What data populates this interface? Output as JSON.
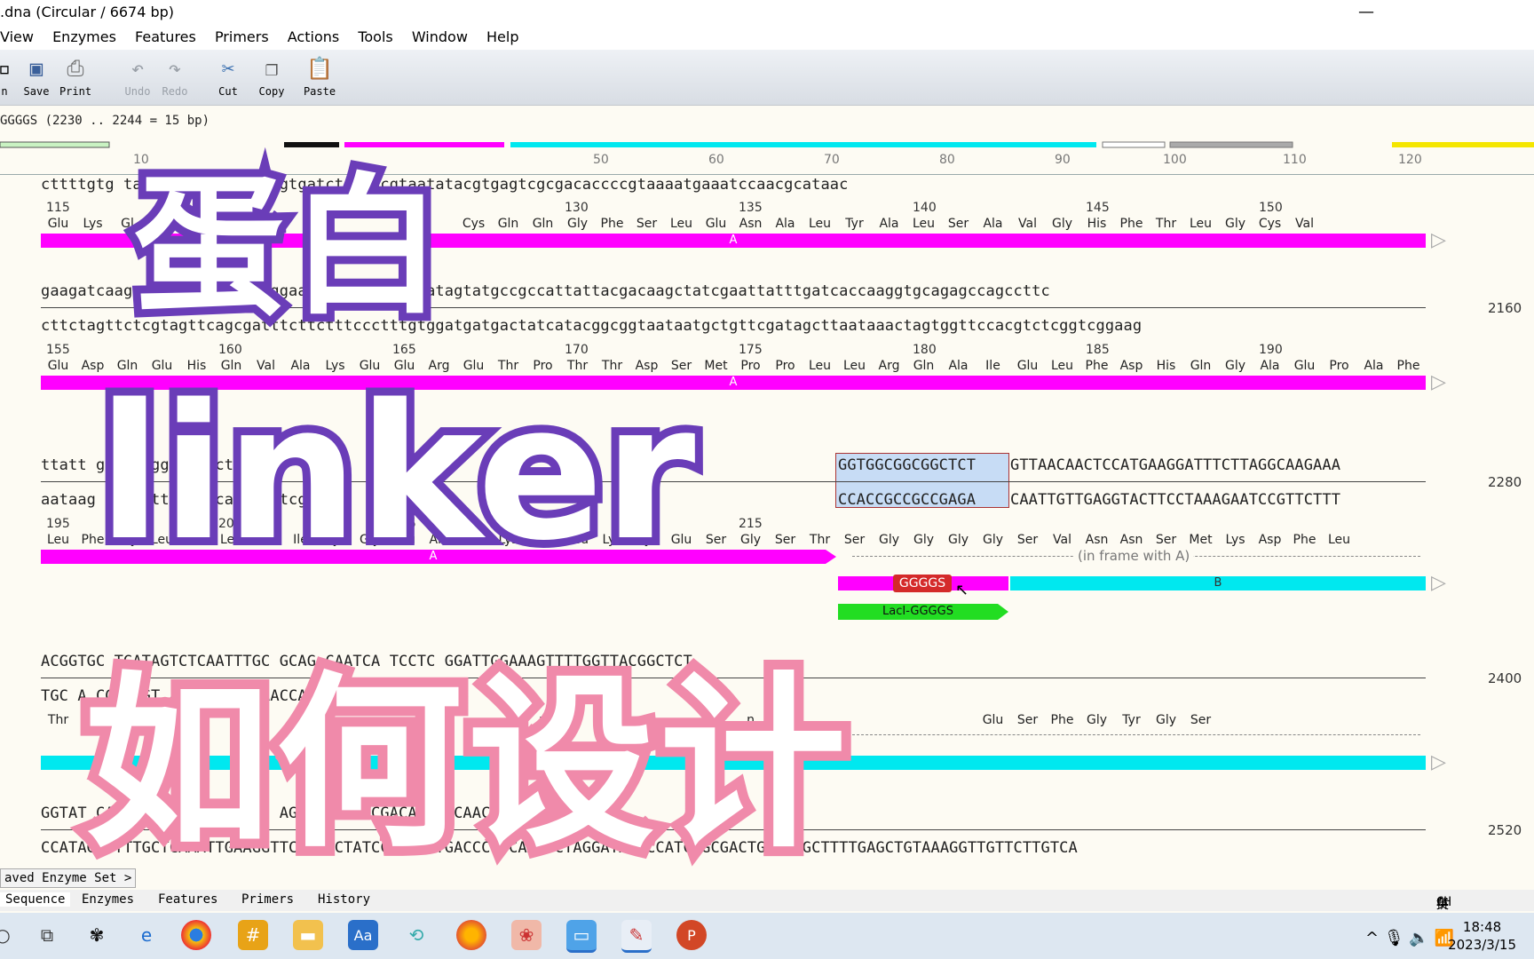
{
  "window": {
    "title": ".dna  (Circular / 6674 bp)",
    "minimize": "—"
  },
  "menu": [
    "View",
    "Enzymes",
    "Features",
    "Primers",
    "Actions",
    "Tools",
    "Window",
    "Help"
  ],
  "toolbar": {
    "save": "Save",
    "print": "Print",
    "undo": "Undo",
    "redo": "Redo",
    "cut": "Cut",
    "copy": "Copy",
    "paste": "Paste",
    "partial": "n"
  },
  "selection_status": "GGGGS (2230 .. 2244 = 15 bp)",
  "ruler": [
    "10",
    "50",
    "60",
    "70",
    "80",
    "90",
    "100",
    "110",
    "120"
  ],
  "rows": [
    {
      "top": "cttttgtg                                 tacggttgttccaaaaagtgatctcttacgtaatatacgtgagtcgcgacaccccgtaaaatgaaatccaacgcataac",
      "numbers": [
        "115",
        "130",
        "135",
        "140",
        "145",
        "150"
      ],
      "aa": [
        "Glu",
        "Lys",
        "Gl",
        "",
        "",
        "u",
        "A",
        "",
        "",
        "",
        "",
        "",
        "Cys",
        "Gln",
        "Gln",
        "Gly",
        "Phe",
        "Ser",
        "Leu",
        "Glu",
        "Asn",
        "Ala",
        "Leu",
        "Tyr",
        "Ala",
        "Leu",
        "Ser",
        "Ala",
        "Val",
        "Gly",
        "His",
        "Phe",
        "Thr",
        "Leu",
        "Gly",
        "Cys",
        "Val",
        "Leu"
      ],
      "feature": "A"
    },
    {
      "top": "gaagatcaag           gctaaagaagaaagggaaacacctactactgatagtatgccgccattattacgacaagctatcgaattatttgatcaccaaggtgcagagccagccttc",
      "bottom": "cttctagttctcgtagttcagcgatttcttctttccctttgtggatgatgactatcatacggcggtaataatgctgttcgatagcttaataaactagtggttccacgtctcggtcggaag",
      "numbers": [
        "155",
        "160",
        "165",
        "170",
        "175",
        "180",
        "185",
        "190"
      ],
      "aa": [
        "Glu",
        "Asp",
        "Gln",
        "Glu",
        "His",
        "Gln",
        "Val",
        "Ala",
        "Lys",
        "Glu",
        "Glu",
        "Arg",
        "Glu",
        "Thr",
        "Pro",
        "Thr",
        "Thr",
        "Asp",
        "Ser",
        "Met",
        "Pro",
        "Pro",
        "Leu",
        "Leu",
        "Arg",
        "Gln",
        "Ala",
        "Ile",
        "Glu",
        "Leu",
        "Phe",
        "Asp",
        "His",
        "Gln",
        "Gly",
        "Ala",
        "Glu",
        "Pro",
        "Ala",
        "Phe"
      ],
      "feature": "A",
      "right": "2160"
    },
    {
      "top_a": "ttatt                                         gaaagtgggtctactagc",
      "sel_top": "GGTGGCGGCGGCTCT",
      "top_b": "GTTAACAACTCCATGAAGGATTTCTTAGGCAAGAAA",
      "bot_a": "aataag                                      cacactttcacccagatgatcg",
      "sel_bot": "CCACCGCCGCCGAGA",
      "bot_b": "CAATTGTTGAGGTACTTCCTAAAGAATCCGTTCTTT",
      "numbers": [
        "195",
        "200",
        "205",
        "210",
        "215"
      ],
      "aa": [
        "Leu",
        "Phe",
        "Gly",
        "Leu",
        "Glu",
        "Leu",
        "Ile",
        "Ile",
        "Cys",
        "Gly",
        "Leu",
        "Ala",
        "Glu",
        "Lys",
        "Gln",
        "Leu",
        "Lys",
        "Cys",
        "Glu",
        "Ser",
        "Gly",
        "Ser",
        "Thr",
        "Ser",
        "Gly",
        "Gly",
        "Gly",
        "Gly",
        "Ser",
        "Val",
        "Asn",
        "Asn",
        "Ser",
        "Met",
        "Lys",
        "Asp",
        "Phe",
        "Leu",
        "Gly",
        "Lys",
        "Lys"
      ],
      "feature_a": "A",
      "in_frame": "(in frame with A)",
      "linker": "GGGGS",
      "feature_b": "B",
      "lacl": "LacI-GGGGS",
      "right": "2280"
    },
    {
      "top": "ACGGTGC      TGATAGTCTCAATTTGC                  GCAG          CAATCA           TCCTC         GGATTGGAAAGTTTTGGTTACGGCTCT",
      "bottom": "TGC                    A                       CGT          AGT                       AACCTTTCAAAACCAATGCCGAGA",
      "aa": [
        "Thr",
        "",
        "",
        "",
        "",
        "",
        "",
        "",
        "",
        "",
        "",
        "",
        "",
        "",
        "n",
        "",
        "",
        "",
        "",
        "",
        "n",
        "",
        "",
        "",
        "",
        "",
        "",
        "Glu",
        "Ser",
        "Phe",
        "Gly",
        "Tyr",
        "Gly",
        "Ser"
      ],
      "right": "2400"
    },
    {
      "top": "GGTAT               CAAGACT              CAGTT              TAGAC             AGGC      AAACTCGACATTTCCAACAAGAACAGT",
      "bottom": "CCATAGTTTTTGCTCAAATTGAAGGTTCTGAACTATCCAAGTTTGACCCGTCAAGTCTAGGATAAACCATCTGCGACTGCTCCGCTTTTGAGCTGTAAAGGTTGTTCTTGTCA",
      "right": "2520"
    }
  ],
  "overlay": {
    "line1": "蛋白",
    "line2": "linker",
    "line3": "如何设计"
  },
  "enzyme_set": "aved Enzyme Set >",
  "bottom_tabs": [
    "Sequence",
    "Enzymes",
    "Features",
    "Primers",
    "History"
  ],
  "ime": [
    "CH",
    "拼",
    "英",
    "♪"
  ],
  "clock": {
    "time": "18:48",
    "date": "2023/3/15"
  },
  "colors": {
    "magenta": "#ff00ff",
    "cyan": "#00e8ef",
    "green": "#22dd22",
    "yellow": "#f4e600",
    "linker_red": "#d42a2a",
    "purple": "#6a3db8",
    "pink": "#f08aaa"
  }
}
